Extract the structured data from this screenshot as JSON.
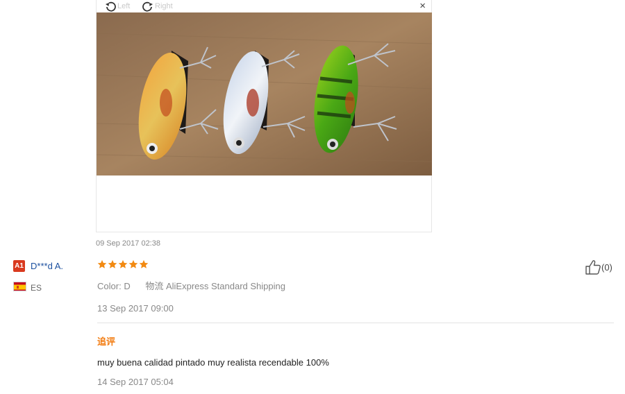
{
  "viewer": {
    "rotate_left_label": "Left",
    "rotate_right_label": "Right",
    "close_label": "×"
  },
  "review": {
    "photo_date": "09 Sep 2017 02:38",
    "badge": "A1",
    "username": "D***d A.",
    "country": "ES",
    "rating": 5,
    "color_label": "Color:",
    "color_value": "D",
    "shipping_prefix": "物流",
    "shipping_method": "AliExpress Standard Shipping",
    "review_date": "13 Sep 2017 09:00",
    "followup_heading": "追评",
    "followup_text": "muy buena calidad pintado muy realista recendable 100%",
    "followup_date": "14 Sep 2017 05:04",
    "helpful_count": "(0)"
  },
  "colors": {
    "accent_orange": "#f27b0f",
    "username_blue": "#1a4f9f",
    "badge_red": "#d93a1f",
    "star_orange": "#f28a12"
  }
}
